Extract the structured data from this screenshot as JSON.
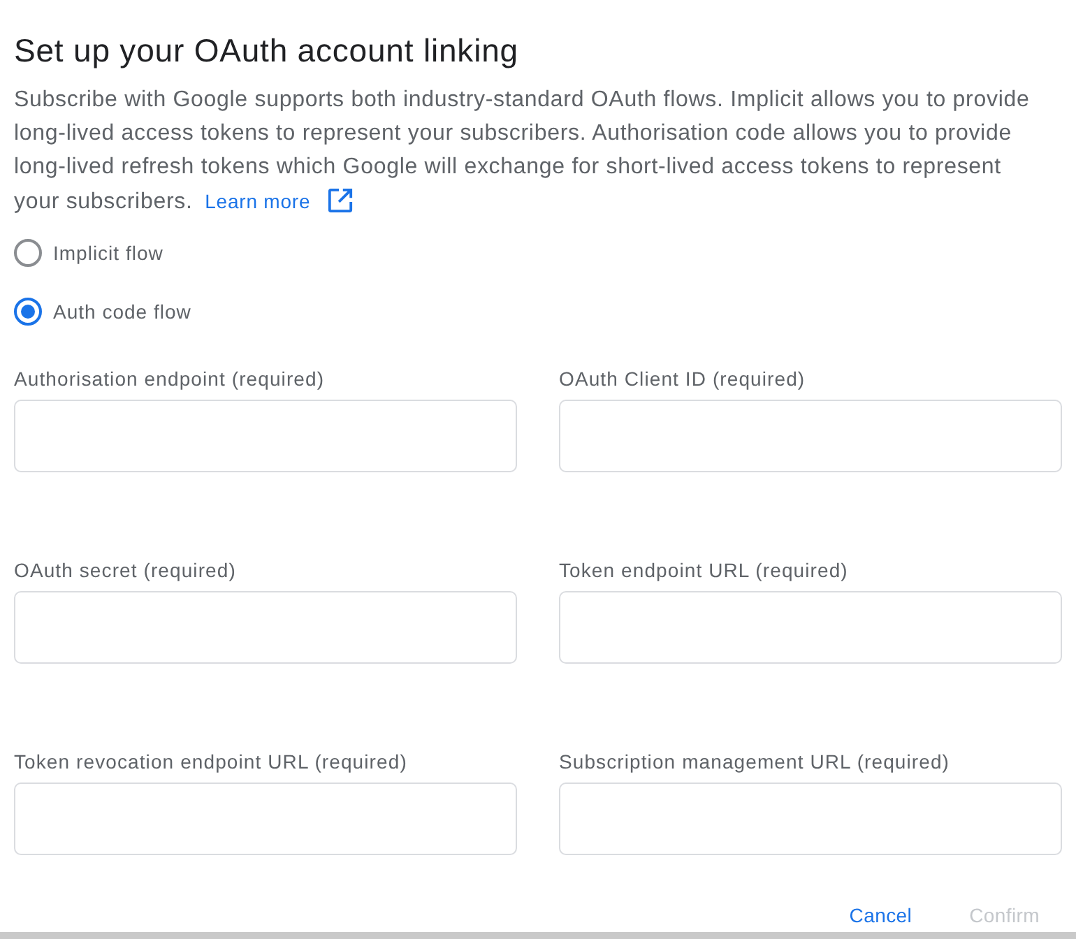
{
  "title": "Set up your OAuth account linking",
  "description": {
    "text": "Subscribe with Google supports both industry-standard OAuth flows. Implicit allows you to provide long-lived access tokens to represent your subscribers. Authorisation code allows you to provide long-lived refresh tokens which Google will exchange for short-lived access tokens to represent your subscribers.",
    "link": "Learn more"
  },
  "flow_options": [
    {
      "label": "Implicit flow",
      "selected": false
    },
    {
      "label": "Auth code flow",
      "selected": true
    }
  ],
  "fields": [
    {
      "label": "Authorisation endpoint (required)"
    },
    {
      "label": "OAuth Client ID (required)"
    },
    {
      "label": "OAuth secret (required)"
    },
    {
      "label": "Token endpoint URL (required)"
    },
    {
      "label": "Token revocation endpoint URL (required)"
    },
    {
      "label": "Subscription management URL (required)"
    }
  ],
  "buttons": [
    {
      "label": "Cancel",
      "disabled": false
    },
    {
      "label": "Confirm",
      "disabled": true
    }
  ]
}
